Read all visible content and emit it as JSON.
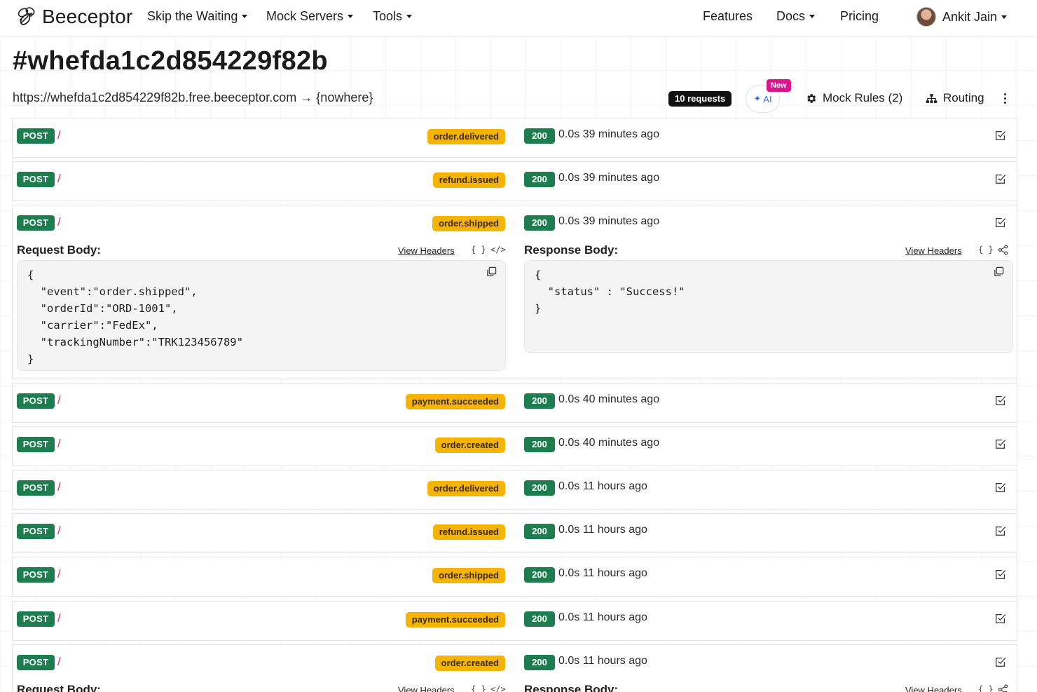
{
  "nav": {
    "brand": "Beeceptor",
    "items": [
      {
        "label": "Skip the Waiting",
        "caret": true
      },
      {
        "label": "Mock Servers",
        "caret": true
      },
      {
        "label": "Tools",
        "caret": true
      },
      {
        "label": "Features",
        "caret": false
      },
      {
        "label": "Docs",
        "caret": true
      },
      {
        "label": "Pricing",
        "caret": false
      }
    ],
    "user": "Ankit Jain"
  },
  "header": {
    "title": "#whefda1c2d854229f82b",
    "url": "https://whefda1c2d854229f82b.free.beeceptor.com → {nowhere}",
    "request_count": "10 requests",
    "ai_label": "AI",
    "new_badge": "New",
    "mock_rules": "Mock Rules (2)",
    "routing": "Routing"
  },
  "requests": [
    {
      "method": "POST",
      "path": "/",
      "event": "order.delivered",
      "status": "200",
      "timing": "0.0s 39 minutes ago"
    },
    {
      "method": "POST",
      "path": "/",
      "event": "refund.issued",
      "status": "200",
      "timing": "0.0s 39 minutes ago"
    },
    {
      "method": "POST",
      "path": "/",
      "event": "order.shipped",
      "status": "200",
      "timing": "0.0s 39 minutes ago"
    },
    {
      "method": "POST",
      "path": "/",
      "event": "payment.succeeded",
      "status": "200",
      "timing": "0.0s 40 minutes ago"
    },
    {
      "method": "POST",
      "path": "/",
      "event": "order.created",
      "status": "200",
      "timing": "0.0s 40 minutes ago"
    },
    {
      "method": "POST",
      "path": "/",
      "event": "order.delivered",
      "status": "200",
      "timing": "0.0s 11 hours ago"
    },
    {
      "method": "POST",
      "path": "/",
      "event": "refund.issued",
      "status": "200",
      "timing": "0.0s 11 hours ago"
    },
    {
      "method": "POST",
      "path": "/",
      "event": "order.shipped",
      "status": "200",
      "timing": "0.0s 11 hours ago"
    },
    {
      "method": "POST",
      "path": "/",
      "event": "payment.succeeded",
      "status": "200",
      "timing": "0.0s 11 hours ago"
    },
    {
      "method": "POST",
      "path": "/",
      "event": "order.created",
      "status": "200",
      "timing": "0.0s 11 hours ago"
    }
  ],
  "detail": {
    "request_label": "Request Body:",
    "response_label": "Response Body:",
    "view_headers": "View Headers",
    "request_body": "{\n  \"event\":\"order.shipped\",\n  \"orderId\":\"ORD-1001\",\n  \"carrier\":\"FedEx\",\n  \"trackingNumber\":\"TRK123456789\"\n}",
    "response_body": "{\n  \"status\" : \"Success!\"\n}"
  },
  "colors": {
    "method_green": "#1e7d4f",
    "event_yellow": "#f4b400",
    "path_red": "#d63053",
    "new_pink": "#d6168a"
  }
}
